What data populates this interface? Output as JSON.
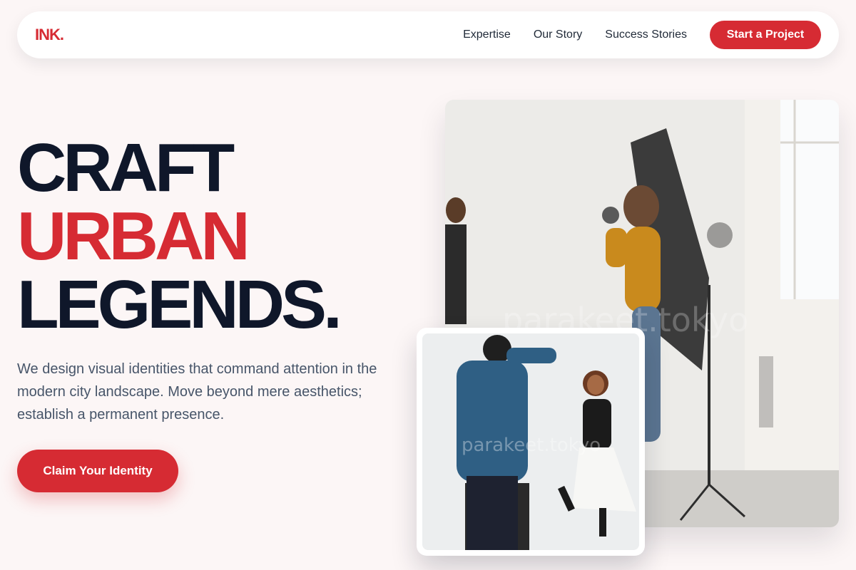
{
  "nav": {
    "logo": "INK.",
    "links": [
      "Expertise",
      "Our Story",
      "Success Stories"
    ],
    "cta": "Start a Project"
  },
  "hero": {
    "line1": "CRAFT",
    "line2": "URBAN",
    "line3": "LEGENDS.",
    "description": "We design visual identities that command attention in the modern city landscape. Move beyond mere aesthetics; establish a permanent presence.",
    "cta": "Claim Your Identity"
  },
  "images": {
    "main_watermark": "parakeet.tokyo",
    "small_watermark": "parakeet.tokyo"
  },
  "colors": {
    "accent": "#d62b33",
    "heading": "#0f172a",
    "body_text": "#475569",
    "background": "#fcf6f6"
  }
}
